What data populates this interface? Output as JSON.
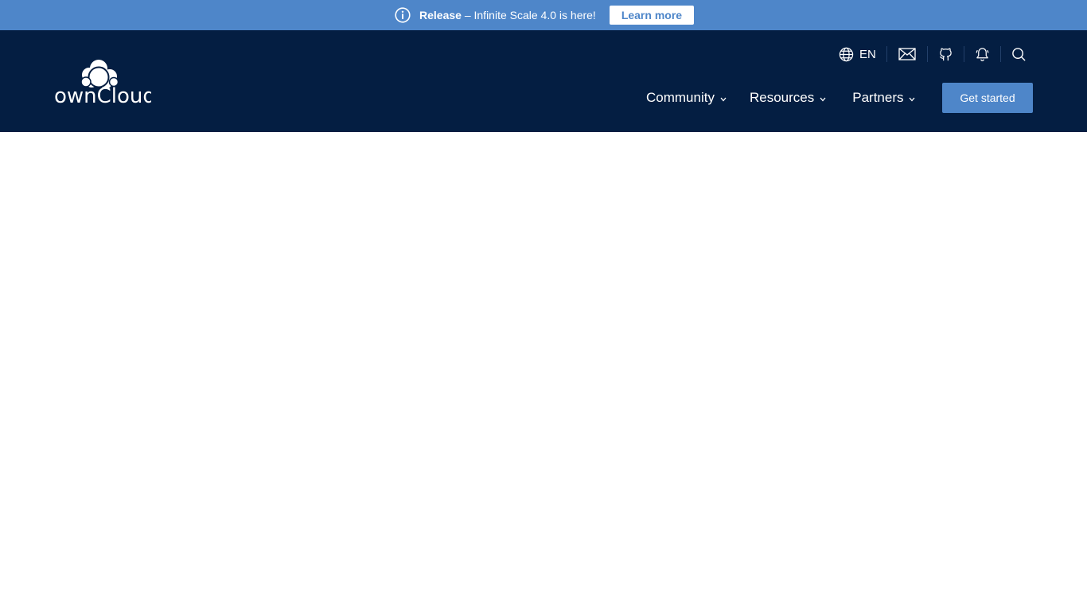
{
  "announcement": {
    "label": "Release",
    "message": " – Infinite Scale 4.0 is here!",
    "button_label": "Learn more",
    "icon": "info-icon"
  },
  "brand": {
    "name": "ownCloud",
    "logo_icon": "owncloud-logo"
  },
  "utility_nav": {
    "language": "EN",
    "language_icon": "globe-icon",
    "mail_icon": "mail-icon",
    "github_icon": "github-icon",
    "notification_icon": "bell-icon",
    "search_icon": "search-icon"
  },
  "main_nav": {
    "items": [
      {
        "label": "Community"
      },
      {
        "label": "Resources"
      },
      {
        "label": "Partners"
      }
    ],
    "cta_label": "Get started"
  },
  "colors": {
    "header_bg": "#041e42",
    "announce_bg": "#4e86c9",
    "accent": "#4e86c9",
    "text_light": "#ffffff"
  }
}
